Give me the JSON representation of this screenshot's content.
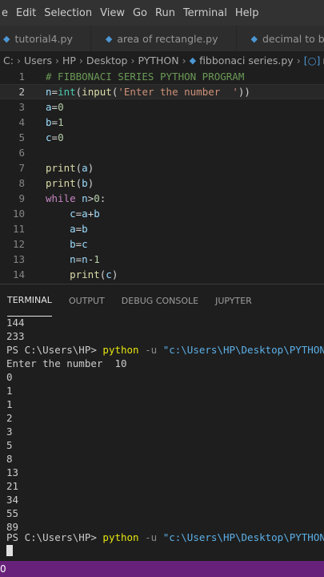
{
  "menubar": {
    "items": [
      "e",
      "Edit",
      "Selection",
      "View",
      "Go",
      "Run",
      "Terminal",
      "Help"
    ]
  },
  "tabs": [
    {
      "label": "tutorial4.py",
      "icon": "python-file-icon"
    },
    {
      "label": "area of rectangle.py",
      "icon": "python-file-icon"
    },
    {
      "label": "decimal to bina",
      "icon": "python-file-icon"
    }
  ],
  "breadcrumb": {
    "items": [
      "C:",
      "Users",
      "HP",
      "Desktop",
      "PYTHON"
    ],
    "file": "fibbonaci series.py",
    "symbol_fragment": "n"
  },
  "editor": {
    "current_line": 2,
    "lines": [
      {
        "num": "1",
        "text": "# FIBBONACI SERIES PYTHON PROGRAM"
      },
      {
        "num": "2",
        "text": "n=int(input('Enter the number  '))"
      },
      {
        "num": "3",
        "text": "a=0"
      },
      {
        "num": "4",
        "text": "b=1"
      },
      {
        "num": "5",
        "text": "c=0"
      },
      {
        "num": "6",
        "text": ""
      },
      {
        "num": "7",
        "text": "print(a)"
      },
      {
        "num": "8",
        "text": "print(b)"
      },
      {
        "num": "9",
        "text": "while n>0:"
      },
      {
        "num": "10",
        "text": "    c=a+b"
      },
      {
        "num": "11",
        "text": "    a=b"
      },
      {
        "num": "12",
        "text": "    b=c"
      },
      {
        "num": "13",
        "text": "    n=n-1"
      },
      {
        "num": "14",
        "text": "    print(c)"
      }
    ]
  },
  "panel": {
    "tabs": [
      "TERMINAL",
      "OUTPUT",
      "DEBUG CONSOLE",
      "JUPYTER"
    ],
    "active_tab": "TERMINAL"
  },
  "terminal": {
    "lines_before": [
      "144",
      "233"
    ],
    "prompt1": {
      "prompt": "PS C:\\Users\\HP> ",
      "command": "python",
      "flag": " -u ",
      "path": "\"c:\\Users\\HP\\Desktop\\PYTHON\\fibb"
    },
    "input_line": "Enter the number  10",
    "output_lines": [
      "0",
      "1",
      "1",
      "2",
      "3",
      "5",
      "8",
      "13",
      "21",
      "34",
      "55",
      "89"
    ],
    "prompt2": {
      "prompt": "PS C:\\Users\\HP> ",
      "command": "python",
      "flag": " -u ",
      "path": "\"c:\\Users\\HP\\Desktop\\PYTHON\\fibb"
    }
  },
  "statusbar": {
    "left_text": "0"
  },
  "colors": {
    "statusbar": "#68217a",
    "editor_bg": "#1e1e1e",
    "comment": "#6a9955",
    "keyword": "#c586c0",
    "string": "#ce9178"
  }
}
